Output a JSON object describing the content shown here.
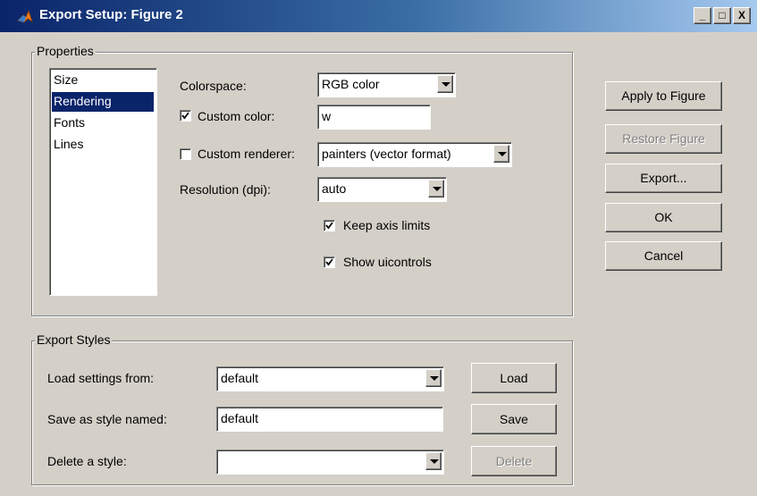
{
  "window": {
    "title": "Export Setup: Figure 2",
    "controls": {
      "minimize": "_",
      "maximize": "□",
      "close": "X"
    },
    "icon": "matlab-icon"
  },
  "properties": {
    "legend": "Properties",
    "list": [
      "Size",
      "Rendering",
      "Fonts",
      "Lines"
    ],
    "selected": "Rendering",
    "colorspace": {
      "label": "Colorspace:",
      "value": "RGB color"
    },
    "custom_color": {
      "label": "Custom color:",
      "checked": true,
      "value": "w"
    },
    "custom_renderer": {
      "label": "Custom renderer:",
      "checked": false,
      "value": "painters (vector format)"
    },
    "resolution": {
      "label": "Resolution (dpi):",
      "value": "auto"
    },
    "keep_axis_limits": {
      "label": "Keep axis limits",
      "checked": true
    },
    "show_uicontrols": {
      "label": "Show uicontrols",
      "checked": true
    }
  },
  "actions": {
    "apply": "Apply to Figure",
    "restore": "Restore Figure",
    "export": "Export...",
    "ok": "OK",
    "cancel": "Cancel"
  },
  "export_styles": {
    "legend": "Export Styles",
    "load_label": "Load settings from:",
    "load_value": "default",
    "load_button": "Load",
    "save_label": "Save as style named:",
    "save_value": "default",
    "save_button": "Save",
    "delete_label": "Delete a style:",
    "delete_value": "",
    "delete_button": "Delete"
  },
  "colors": {
    "face": "#d4d0c8",
    "title_start": "#0a246a",
    "title_end": "#a6caf0",
    "selection": "#0a246a"
  }
}
